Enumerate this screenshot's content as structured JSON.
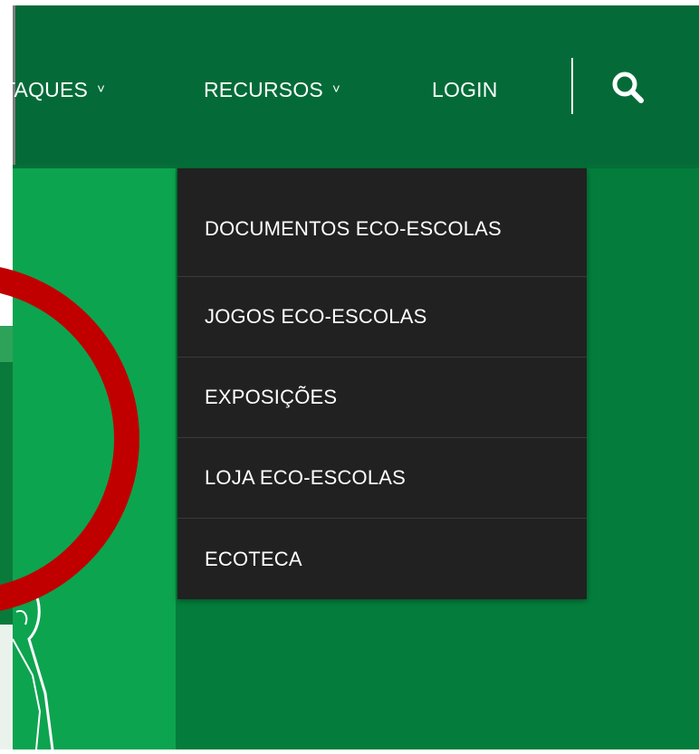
{
  "nav": {
    "items": [
      {
        "label": "TAQUES",
        "has_chevron": true
      },
      {
        "label": "RECURSOS",
        "has_chevron": true
      },
      {
        "label": "LOGIN",
        "has_chevron": false
      }
    ],
    "chevron_glyph": "˅",
    "search_icon": "search-icon"
  },
  "dropdown": {
    "items": [
      {
        "label": "DOCUMENTOS ECO-ESCOLAS"
      },
      {
        "label": "JOGOS ECO-ESCOLAS"
      },
      {
        "label": "EXPOSIÇÕES"
      },
      {
        "label": "LOJA ECO-ESCOLAS"
      },
      {
        "label": "ECOTECA"
      }
    ]
  },
  "colors": {
    "navbar": "#046b38",
    "dropdown_bg": "#212121",
    "highlight_ring": "#c00000",
    "panel_light_green": "#0da44f",
    "panel_dark_green": "#047d3c"
  }
}
